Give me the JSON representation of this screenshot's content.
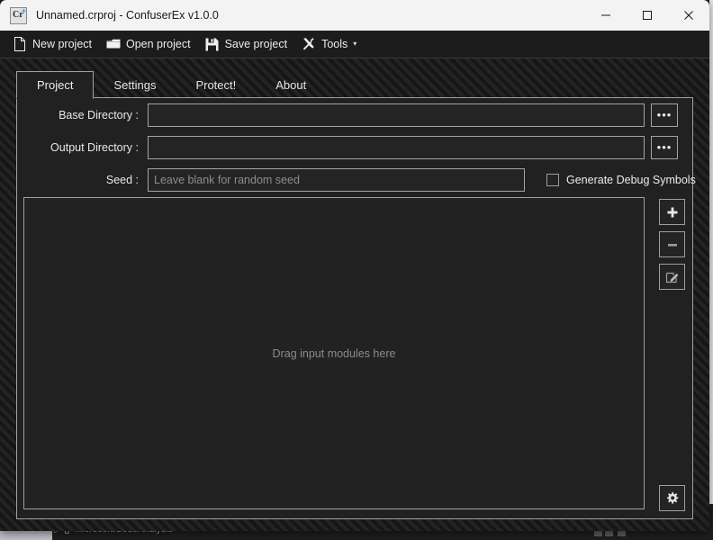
{
  "window": {
    "title": "Unnamed.crproj - ConfuserEx v1.0.0",
    "app_icon_text": "Cr",
    "app_icon_badge": "+",
    "controls": {
      "minimize": "minimize-icon",
      "maximize": "maximize-icon",
      "close": "close-icon"
    }
  },
  "toolbar": {
    "items": [
      {
        "label": "New project",
        "icon": "new-document-icon"
      },
      {
        "label": "Open project",
        "icon": "open-folder-icon"
      },
      {
        "label": "Save project",
        "icon": "floppy-disk-icon"
      },
      {
        "label": "Tools",
        "icon": "hammer-wrench-icon",
        "caret": "▾"
      }
    ]
  },
  "tabs": [
    {
      "label": "Project",
      "active": true
    },
    {
      "label": "Settings",
      "active": false
    },
    {
      "label": "Protect!",
      "active": false
    },
    {
      "label": "About",
      "active": false
    }
  ],
  "project_tab": {
    "base_directory": {
      "label": "Base Directory :",
      "value": "",
      "placeholder": "",
      "browse_label": "•••"
    },
    "output_directory": {
      "label": "Output Directory :",
      "value": "",
      "placeholder": "",
      "browse_label": "•••"
    },
    "seed": {
      "label": "Seed :",
      "value": "",
      "placeholder": "Leave blank for random seed"
    },
    "debug_symbols": {
      "label": "Generate Debug Symbols",
      "checked": false
    },
    "modules_list": {
      "placeholder": "Drag input modules here",
      "items": []
    },
    "side_buttons": [
      {
        "name": "add-module-button",
        "icon": "plus-icon",
        "label": "+"
      },
      {
        "name": "remove-module-button",
        "icon": "minus-icon",
        "label": "−"
      },
      {
        "name": "edit-module-button",
        "icon": "edit-pencil-icon"
      }
    ],
    "settings_button": {
      "icon": "gear-icon"
    }
  },
  "background": {
    "code_node": "Microsoft.CodeAnalysis",
    "code_node_arrow": "▷",
    "code_node_braces": "{}"
  },
  "colors": {
    "window_bg": "#1c1c1c",
    "panel_bg": "#212121",
    "titlebar_bg": "#f3f3f3",
    "border": "#a0a0a0",
    "text": "#ececec",
    "placeholder": "#8b8b8b",
    "code_yellow": "#d7b860",
    "icon_badge_blue": "#3b9ae1"
  }
}
